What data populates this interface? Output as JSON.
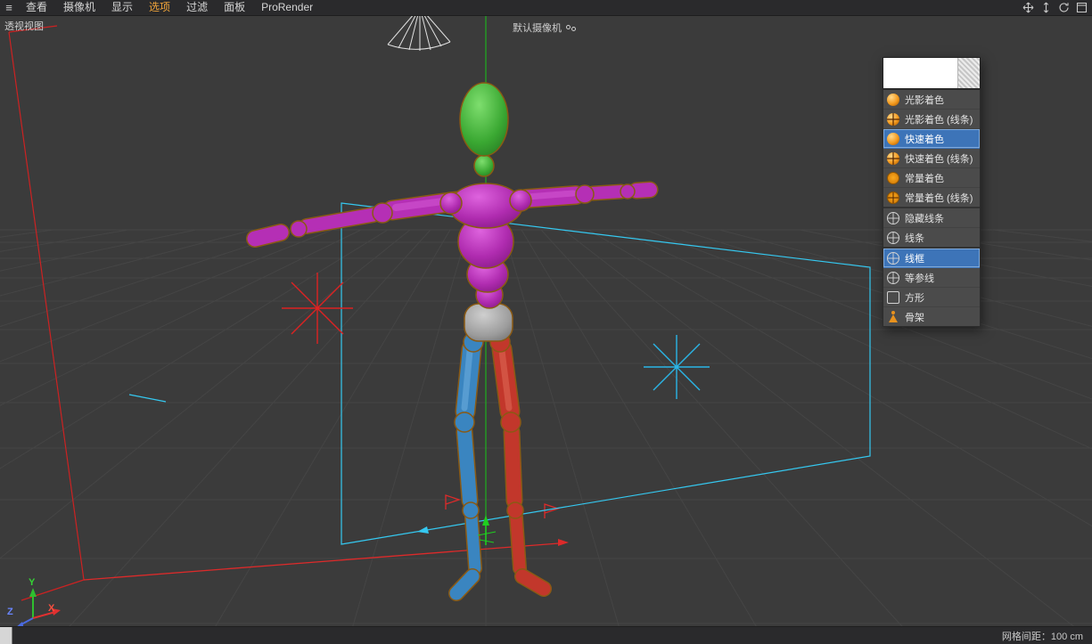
{
  "menubar": {
    "items": [
      {
        "label": "查看",
        "active": false
      },
      {
        "label": "摄像机",
        "active": false
      },
      {
        "label": "显示",
        "active": false
      },
      {
        "label": "选项",
        "active": true
      },
      {
        "label": "过滤",
        "active": false
      },
      {
        "label": "面板",
        "active": false
      },
      {
        "label": "ProRender",
        "active": false
      }
    ],
    "icons": [
      "hamburger-icon",
      "pan-icon",
      "dolly-icon",
      "orbit-icon",
      "maximize-icon"
    ]
  },
  "viewport": {
    "view_label": "透视视图",
    "camera_label": "默认摄像机"
  },
  "shading_menu": {
    "items": [
      {
        "label": "光影着色",
        "icon": "shaded-sphere",
        "selected": false,
        "group_end": false
      },
      {
        "label": "光影着色 (线条)",
        "icon": "shaded-sphere-lines",
        "selected": false,
        "group_end": false
      },
      {
        "label": "快速着色",
        "icon": "quick-sphere",
        "selected": true,
        "group_end": false
      },
      {
        "label": "快速着色 (线条)",
        "icon": "quick-sphere-lines",
        "selected": false,
        "group_end": false
      },
      {
        "label": "常量着色",
        "icon": "constant-sphere",
        "selected": false,
        "group_end": false
      },
      {
        "label": "常量着色 (线条)",
        "icon": "constant-sphere-lines",
        "selected": false,
        "group_end": true
      },
      {
        "label": "隐藏线条",
        "icon": "hidden-line-sphere",
        "selected": false,
        "group_end": false
      },
      {
        "label": "线条",
        "icon": "line-sphere",
        "selected": false,
        "group_end": true
      },
      {
        "label": "线框",
        "icon": "wireframe-sphere",
        "selected": true,
        "group_end": false
      },
      {
        "label": "等参线",
        "icon": "isoparm-sphere",
        "selected": false,
        "group_end": false
      },
      {
        "label": "方形",
        "icon": "box",
        "selected": false,
        "group_end": false
      },
      {
        "label": "骨架",
        "icon": "skeleton",
        "selected": false,
        "group_end": false
      }
    ]
  },
  "status_bar": {
    "grid_spacing_label": "网格间距：100 cm"
  },
  "axis_gizmo": {
    "x_label": "X",
    "y_label": "Y",
    "z_label": "Z"
  },
  "colors": {
    "selection_blue": "#3d74b8",
    "menu_active_orange": "#f0a43a",
    "head_green": "#3aa832",
    "torso_magenta": "#b52fb5",
    "pelvis_gray": "#9c9c9c",
    "left_leg_blue": "#3a85c0",
    "right_leg_red": "#c2372b",
    "camera_frame_cyan": "#35c8f0",
    "light_gizmo_red": "#dd2222",
    "light_gizmo_cyan": "#2ab6e8",
    "axis_green": "#2fbf2f",
    "axis_red": "#e03030",
    "outline_orange": "#8a5a14"
  }
}
